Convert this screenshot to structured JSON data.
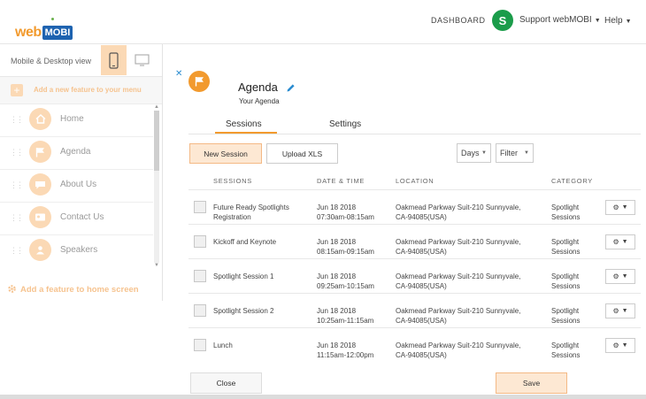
{
  "header": {
    "logo_part1": "web",
    "logo_part2": "MOBI",
    "dashboard": "DASHBOARD",
    "avatar_initial": "S",
    "user": "Support webMOBI",
    "help": "Help"
  },
  "sidebar": {
    "view_label": "Mobile & Desktop view",
    "add_feature_menu": "Add a new feature to your menu",
    "items": [
      {
        "label": "Home",
        "icon": "home-icon"
      },
      {
        "label": "Agenda",
        "icon": "flag-icon"
      },
      {
        "label": "About Us",
        "icon": "chat-icon"
      },
      {
        "label": "Contact Us",
        "icon": "contact-icon"
      },
      {
        "label": "Speakers",
        "icon": "speakers-icon"
      }
    ],
    "add_feature_home": "Add a feature to home screen"
  },
  "panel": {
    "title": "Agenda",
    "subtitle": "Your Agenda",
    "tabs": [
      "Sessions",
      "Settings"
    ],
    "new_session": "New Session",
    "upload_xls": "Upload XLS",
    "days_select": "Days",
    "filter_select": "Filter",
    "columns": [
      "SESSIONS",
      "DATE & TIME",
      "LOCATION",
      "CATEGORY"
    ],
    "rows": [
      {
        "name": [
          "Future Ready Spotlights",
          "Registration"
        ],
        "date": [
          "Jun 18 2018",
          "07:30am-08:15am"
        ],
        "location": [
          "Oakmead Parkway Suit-210 Sunnyvale,",
          "CA-94085(USA)"
        ],
        "category": [
          "Spotlight",
          "Sessions"
        ]
      },
      {
        "name": [
          "Kickoff and Keynote",
          ""
        ],
        "date": [
          "Jun 18 2018",
          "08:15am-09:15am"
        ],
        "location": [
          "Oakmead Parkway Suit-210 Sunnyvale,",
          "CA-94085(USA)"
        ],
        "category": [
          "Spotlight",
          "Sessions"
        ]
      },
      {
        "name": [
          "Spotlight Session 1",
          ""
        ],
        "date": [
          "Jun 18 2018",
          "09:25am-10:15am"
        ],
        "location": [
          "Oakmead Parkway Suit-210 Sunnyvale,",
          "CA-94085(USA)"
        ],
        "category": [
          "Spotlight",
          "Sessions"
        ]
      },
      {
        "name": [
          "Spotlight Session 2",
          ""
        ],
        "date": [
          "Jun 18 2018",
          "10:25am-11:15am"
        ],
        "location": [
          "Oakmead Parkway Suit-210 Sunnyvale,",
          "CA-94085(USA)"
        ],
        "category": [
          "Spotlight",
          "Sessions"
        ]
      },
      {
        "name": [
          "Lunch",
          ""
        ],
        "date": [
          "Jun 18 2018",
          "11:15am-12:00pm"
        ],
        "location": [
          "Oakmead Parkway Suit-210 Sunnyvale,",
          "CA-94085(USA)"
        ],
        "category": [
          "Spotlight",
          "Sessions"
        ]
      }
    ],
    "close": "Close",
    "save": "Save"
  },
  "colors": {
    "accent": "#f29a2e",
    "accent_light": "#fde8d3",
    "logo_blue": "#1e63b0",
    "avatar_green": "#1b9c4a"
  }
}
